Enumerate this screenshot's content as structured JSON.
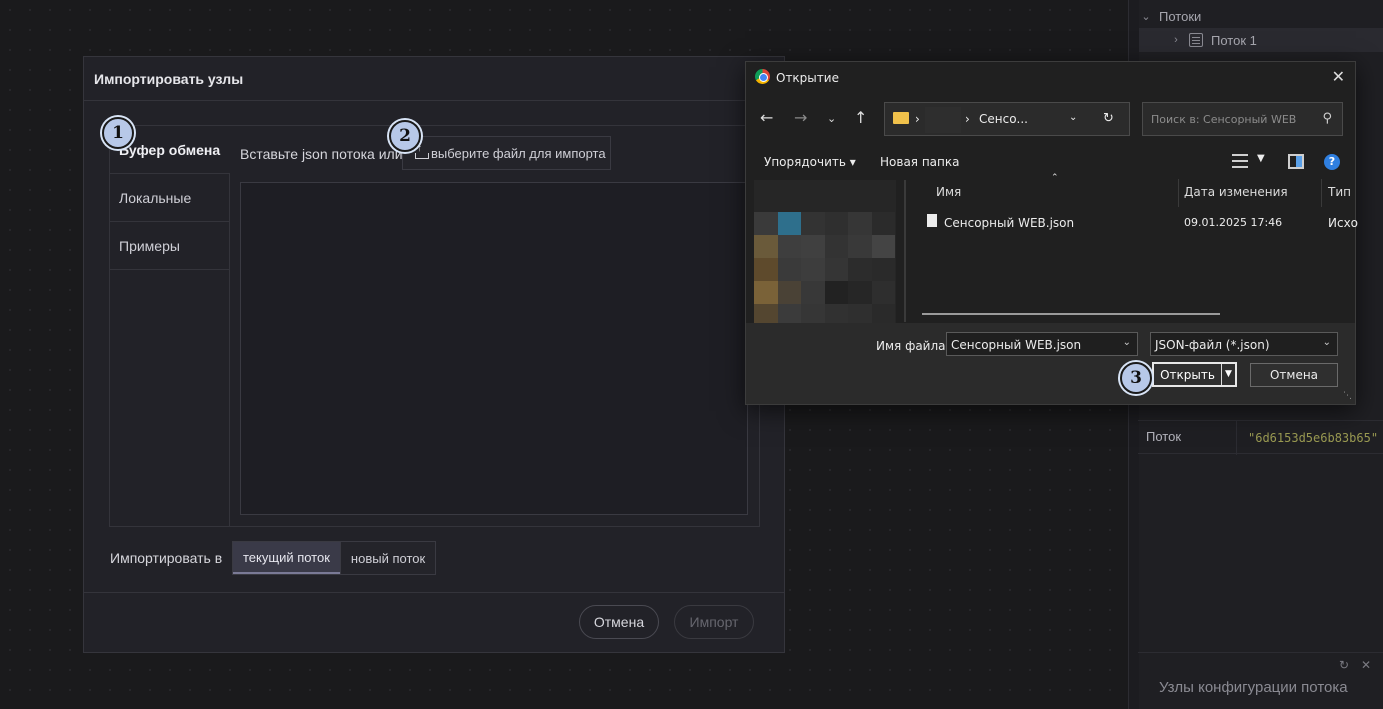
{
  "sidebar": {
    "flows_label": "Потоки",
    "flow_item": "Поток 1",
    "prop_key": "Поток",
    "prop_value": "\"6d6153d5e6b83b65\"",
    "footer_title": "Узлы конфигурации потока"
  },
  "import_dialog": {
    "title": "Импортировать узлы",
    "tabs": [
      {
        "label": "Буфер обмена"
      },
      {
        "label": "Локальные"
      },
      {
        "label": "Примеры"
      }
    ],
    "paste_label": "Вставьте json потока или",
    "file_button": "выберите файл для импорта",
    "import_into_label": "Импортировать в",
    "target_current": "текущий поток",
    "target_new": "новый поток",
    "cancel": "Отмена",
    "import": "Импорт"
  },
  "markers": [
    "1",
    "2",
    "3"
  ],
  "file_dialog": {
    "title": "Открытие",
    "path_segment": "Сенсо...",
    "search_placeholder": "Поиск в: Сенсорный WEB",
    "organize": "Упорядочить",
    "new_folder": "Новая папка",
    "columns": {
      "name": "Имя",
      "date": "Дата изменения",
      "type": "Тип"
    },
    "files": [
      {
        "name": "Сенсорный WEB.json",
        "date": "09.01.2025 17:46",
        "type": "Исхо"
      }
    ],
    "filename_label": "Имя файла:",
    "filename_value": "Сенсорный WEB.json",
    "filetype_value": "JSON-файл (*.json)",
    "open": "Открыть",
    "cancel": "Отмена",
    "help": "?",
    "brand_colors": {
      "chrome_red": "#db4437",
      "chrome_yellow": "#f4b400",
      "chrome_green": "#0f9d58",
      "chrome_blue": "#4285f4",
      "folder": "#f0c14b"
    }
  }
}
